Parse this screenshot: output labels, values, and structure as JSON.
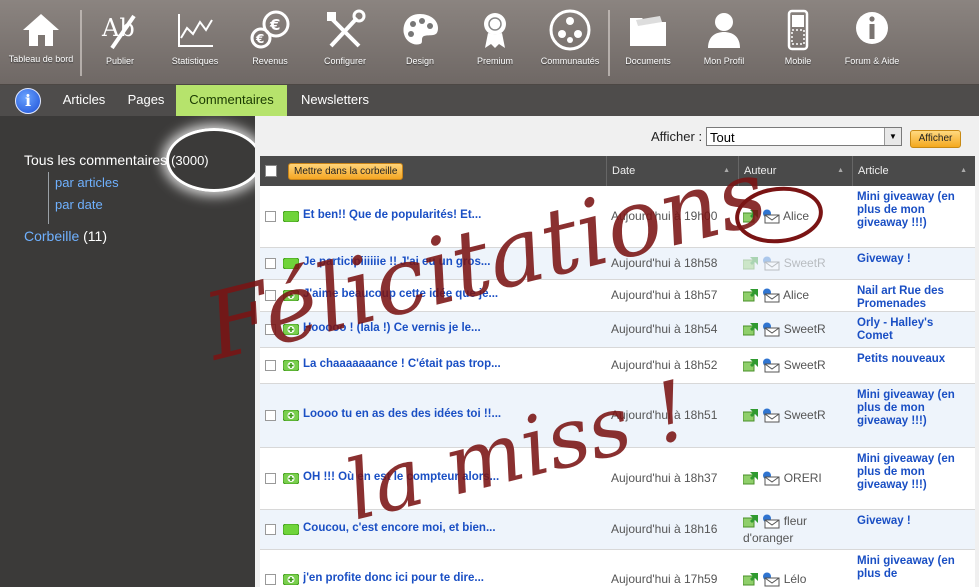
{
  "toolbar": {
    "items": [
      {
        "label": "Tableau de bord",
        "icon": "home-icon"
      },
      {
        "label": "Publier",
        "icon": "pen-icon"
      },
      {
        "label": "Statistiques",
        "icon": "chart-icon"
      },
      {
        "label": "Revenus",
        "icon": "coins-icon"
      },
      {
        "label": "Configurer",
        "icon": "tools-icon"
      },
      {
        "label": "Design",
        "icon": "palette-icon"
      },
      {
        "label": "Premium",
        "icon": "award-icon"
      },
      {
        "label": "Communautés",
        "icon": "community-icon"
      },
      {
        "label": "Documents",
        "icon": "folder-icon"
      },
      {
        "label": "Mon Profil",
        "icon": "user-icon"
      },
      {
        "label": "Mobile",
        "icon": "mobile-icon"
      },
      {
        "label": "Forum & Aide",
        "icon": "info-icon"
      }
    ]
  },
  "tabs": {
    "info_glyph": "i",
    "items": [
      "Articles",
      "Pages",
      "Commentaires",
      "Newsletters"
    ],
    "active": "Commentaires"
  },
  "sidebar": {
    "all_label": "Tous les commentaires",
    "all_count": "(3000)",
    "by_articles": "par articles",
    "by_date": "par date",
    "trash_label": "Corbeille",
    "trash_count": "(11)"
  },
  "filter": {
    "label": "Afficher :",
    "value": "Tout",
    "button": "Afficher"
  },
  "table": {
    "trash_button": "Mettre dans la corbeille",
    "col_date": "Date",
    "col_author": "Auteur",
    "col_article": "Article",
    "rows": [
      {
        "comment": "Et ben!! Que de popularités! Et...",
        "date": "Aujourd'hui à 19h00",
        "author": "Alice",
        "article": "Mini giveaway (en plus de mon giveaway !!!)",
        "icon": "green"
      },
      {
        "comment": "Je participiiiiiie !! J'ai eu un gros...",
        "date": "Aujourd'hui à 18h58",
        "author": "SweetR",
        "article": "Giveway !",
        "icon": "green"
      },
      {
        "comment": "J'aime beaucoup cette idée que je...",
        "date": "Aujourd'hui à 18h57",
        "author": "Alice",
        "article": "Nail art Rue des Promenades",
        "icon": "add"
      },
      {
        "comment": "Hooooo ! (lala !) Ce vernis je le...",
        "date": "Aujourd'hui à 18h54",
        "author": "SweetR",
        "article": "Orly - Halley's Comet",
        "icon": "add"
      },
      {
        "comment": "La chaaaaaaance ! C'était pas trop...",
        "date": "Aujourd'hui à 18h52",
        "author": "SweetR",
        "article": "Petits nouveaux",
        "icon": "add"
      },
      {
        "comment": "Loooo tu en as des des idées toi !!...",
        "date": "Aujourd'hui à 18h51",
        "author": "SweetR",
        "article": "Mini giveaway (en plus de mon giveaway !!!)",
        "icon": "add"
      },
      {
        "comment": "OH !!! Où en est le compteur alors...",
        "date": "Aujourd'hui à 18h37",
        "author": "ORERI",
        "article": "Mini giveaway (en plus de mon giveaway !!!)",
        "icon": "add"
      },
      {
        "comment": "Coucou, c'est encore moi, et bien...",
        "date": "Aujourd'hui à 18h16",
        "author": "fleur d'oranger",
        "article": "Giveway !",
        "icon": "green"
      },
      {
        "comment": "j'en profite donc ici pour te dire...",
        "date": "Aujourd'hui à 17h59",
        "author": "Lélo",
        "article": "Mini giveaway (en plus de",
        "icon": "add"
      }
    ]
  },
  "overlay": {
    "line1": "Félicitations",
    "line2": "la miss !",
    "color": "#7a1414"
  },
  "colors": {
    "accent_tab": "#b6e36c",
    "link_blue": "#1a4fc4",
    "button_orange": "#f5a623"
  }
}
